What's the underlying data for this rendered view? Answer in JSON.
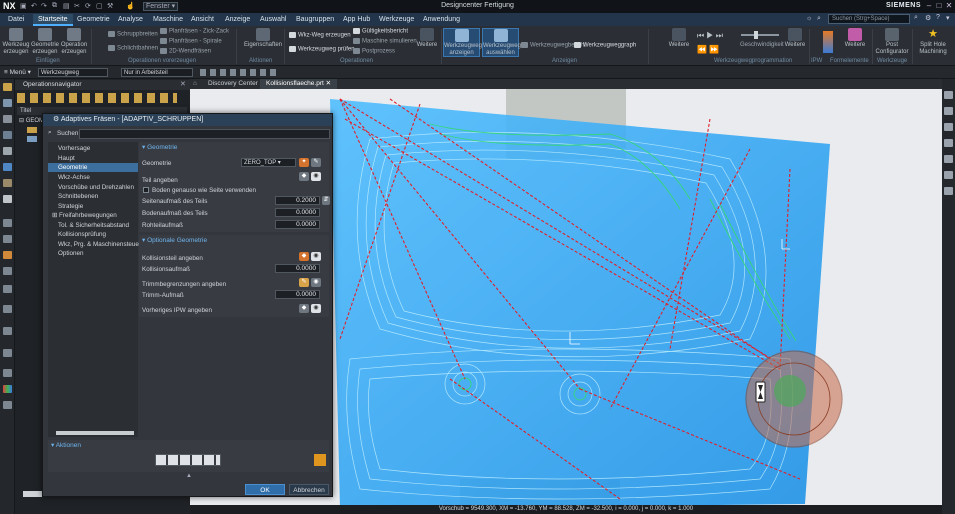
{
  "app": {
    "logo": "NX",
    "window_title": "Designcenter Fertigung",
    "brand": "SIEMENS",
    "window_dropdown": "Fenster"
  },
  "menu_tabs": [
    "Datei",
    "Startseite",
    "Geometrie",
    "Analyse",
    "Maschine",
    "Ansicht",
    "Anzeige",
    "Auswahl",
    "Baugruppen",
    "App Hub",
    "Werkzeuge",
    "Anwendung"
  ],
  "search_placeholder": "Suchen (Strg+Space)",
  "ribbon": {
    "buttons": {
      "werkzeug_erzeugen": "Werkzeug erzeugen",
      "geometrie_erzeugen": "Geometrie erzeugen",
      "operation_erzeugen": "Operation erzeugen",
      "schruppbreiten": "Schruppbreiten",
      "schlichtbahnen": "Schlichtbahnen",
      "planfraesen_zick": "Planfräsen - Zick-Zack",
      "planfraesen_spirale": "Planfräsen - Spirale",
      "wendelfraesen_2d": "2D-Wendfräsen",
      "eigenschaften": "Eigenschaften",
      "wkz_weg_erzeugen": "Wkz-Weg erzeugen",
      "werkzeugweg_pruefen": "Werkzeugweg prüfen",
      "gueltigkeitsbericht": "Gültigkeitsbericht",
      "maschine_simulieren": "Maschine simulieren",
      "postprozess": "Postprozess",
      "weitere1": "Weitere",
      "werkzeugweg_anzeigen": "Werkzeugweg anzeigen",
      "werkzeugweg_auswaehlen": "Werkzeugweg auswählen",
      "werkzeugwegbericht": "Werkzeugwegbericht",
      "werkzeugweggraph": "Werkzeugweggraph",
      "weitere2": "Weitere",
      "geschwindigkeit": "Geschwindigkeit",
      "weitere3": "Weitere",
      "weitere4": "Weitere",
      "post_configurator": "Post Configurator",
      "split_hole_machining": "Split Hole Machining"
    },
    "groups": {
      "einfuegen": "Einfügen",
      "operationen_vorerzeugen": "Operationen vorerzeugen",
      "aktionen": "Aktionen",
      "operationen": "Operationen",
      "anzeigen": "Anzeigen",
      "werkzeugwegprogrammation": "Werkzeugwegprogrammation",
      "ipw": "IPW",
      "formelemente": "Formelemente",
      "werkzeuge": "Werkzeuge"
    }
  },
  "selection_bar": {
    "menu_label": "Menü",
    "filter_value": "Werkzeugweg",
    "scope_value": "Nur in Arbeitsteil"
  },
  "navigator": {
    "title": "Operationsnavigator",
    "name_header": "Titel",
    "root_label": "GEOM"
  },
  "viewport_tabs": [
    "Discovery Center",
    "Kollisionsflaeche.prt"
  ],
  "dialog": {
    "title": "Adaptives Fräsen - [ADAPTIV_SCHRUPPEN]",
    "search_label": "Suchen",
    "tree": [
      "Vorhersage",
      "Haupt",
      "Geometrie",
      "Wkz-Achse",
      "Vorschübe und Drehzahlen",
      "Schnittebenen",
      "Strategie",
      "Freifahrbewegungen",
      "Tol. & Sicherheitsabstand",
      "Kollisionsprüfung",
      "Wkz, Prg. & Maschinensteue",
      "Optionen"
    ],
    "selected_tree_index": 2,
    "sections": {
      "geometrie": "Geometrie",
      "optionale_geometrie": "Optionale Geometrie",
      "aktionen": "Aktionen"
    },
    "fields": {
      "geometrie_label": "Geometrie",
      "geometrie_value": "ZERO_TOP",
      "teil_angeben": "Teil angeben",
      "boden_genauso": "Boden genauso wie Seite verwenden",
      "seitenaufmass_label": "Seitenaufmaß des Teils",
      "seitenaufmass_value": "0.2000",
      "bodenaufmass_label": "Bodenaufmaß des Teils",
      "bodenaufmass_value": "0.0000",
      "rohteilaufmass_label": "Rohteilaufmaß",
      "rohteilaufmass_value": "0.0000",
      "kollisionsteil_label": "Kollisionsteil angeben",
      "kollisionsaufmass_label": "Kollisionsaufmaß",
      "kollisionsaufmass_value": "0.0000",
      "trimmbegrenzungen_label": "Trimmbegrenzungen angeben",
      "trimm_aufmass_label": "Trimm-Aufmaß",
      "trimm_aufmass_value": "0.0000",
      "vorheriges_ipw_label": "Vorheriges IPW angeben"
    },
    "ok_label": "OK",
    "cancel_label": "Abbrechen"
  },
  "status": "Vorschub = 9549.300, XM = -13.760, YM = 88.528, ZM = -32.500, i = 0.000, j = 0.000, k = 1.000",
  "colors": {
    "accent": "#4fb0ff",
    "part_blue": "#1ea5ff",
    "toolpath_red": "#e0202a",
    "toolpath_green": "#35d67a",
    "tool_orange": "#c86a4a"
  }
}
